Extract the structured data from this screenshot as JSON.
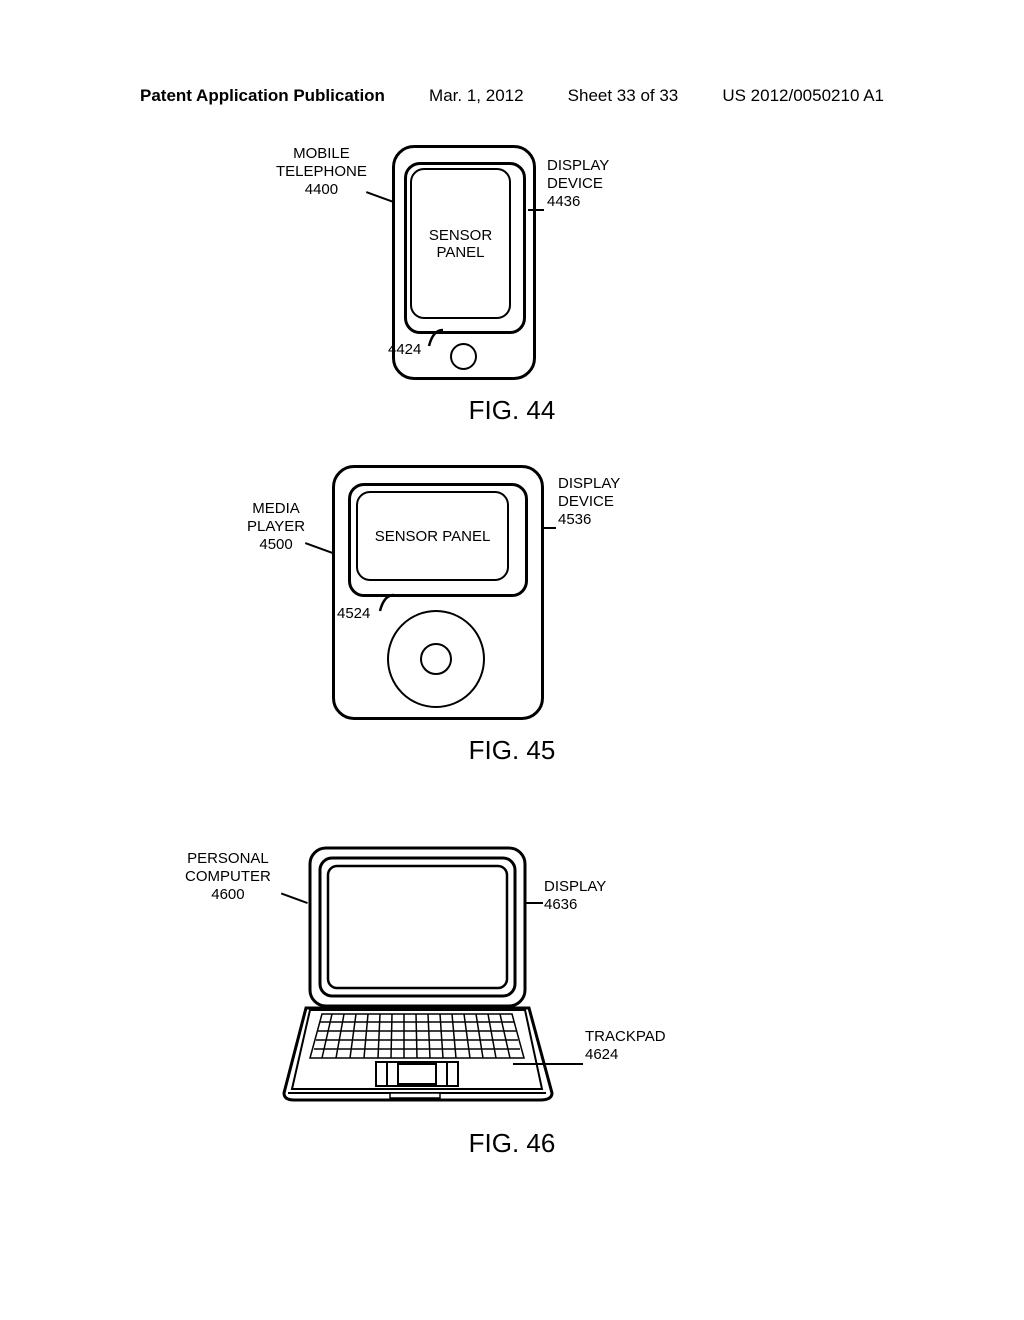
{
  "header": {
    "left": "Patent Application Publication",
    "date": "Mar. 1, 2012",
    "sheet": "Sheet 33 of 33",
    "pubnum": "US 2012/0050210 A1"
  },
  "fig44": {
    "caption": "FIG. 44",
    "deviceLabel": "MOBILE\nTELEPHONE",
    "deviceRef": "4400",
    "displayLabel": "DISPLAY\nDEVICE",
    "displayRef": "4436",
    "sensor": "SENSOR\nPANEL",
    "sensorRef": "4424"
  },
  "fig45": {
    "caption": "FIG. 45",
    "deviceLabel": "MEDIA\nPLAYER",
    "deviceRef": "4500",
    "displayLabel": "DISPLAY\nDEVICE",
    "displayRef": "4536",
    "sensor": "SENSOR PANEL",
    "sensorRef": "4524"
  },
  "fig46": {
    "caption": "FIG. 46",
    "deviceLabel": "PERSONAL\nCOMPUTER",
    "deviceRef": "4600",
    "displayLabel": "DISPLAY",
    "displayRef": "4636",
    "trackpadLabel": "TRACKPAD",
    "trackpadRef": "4624"
  }
}
